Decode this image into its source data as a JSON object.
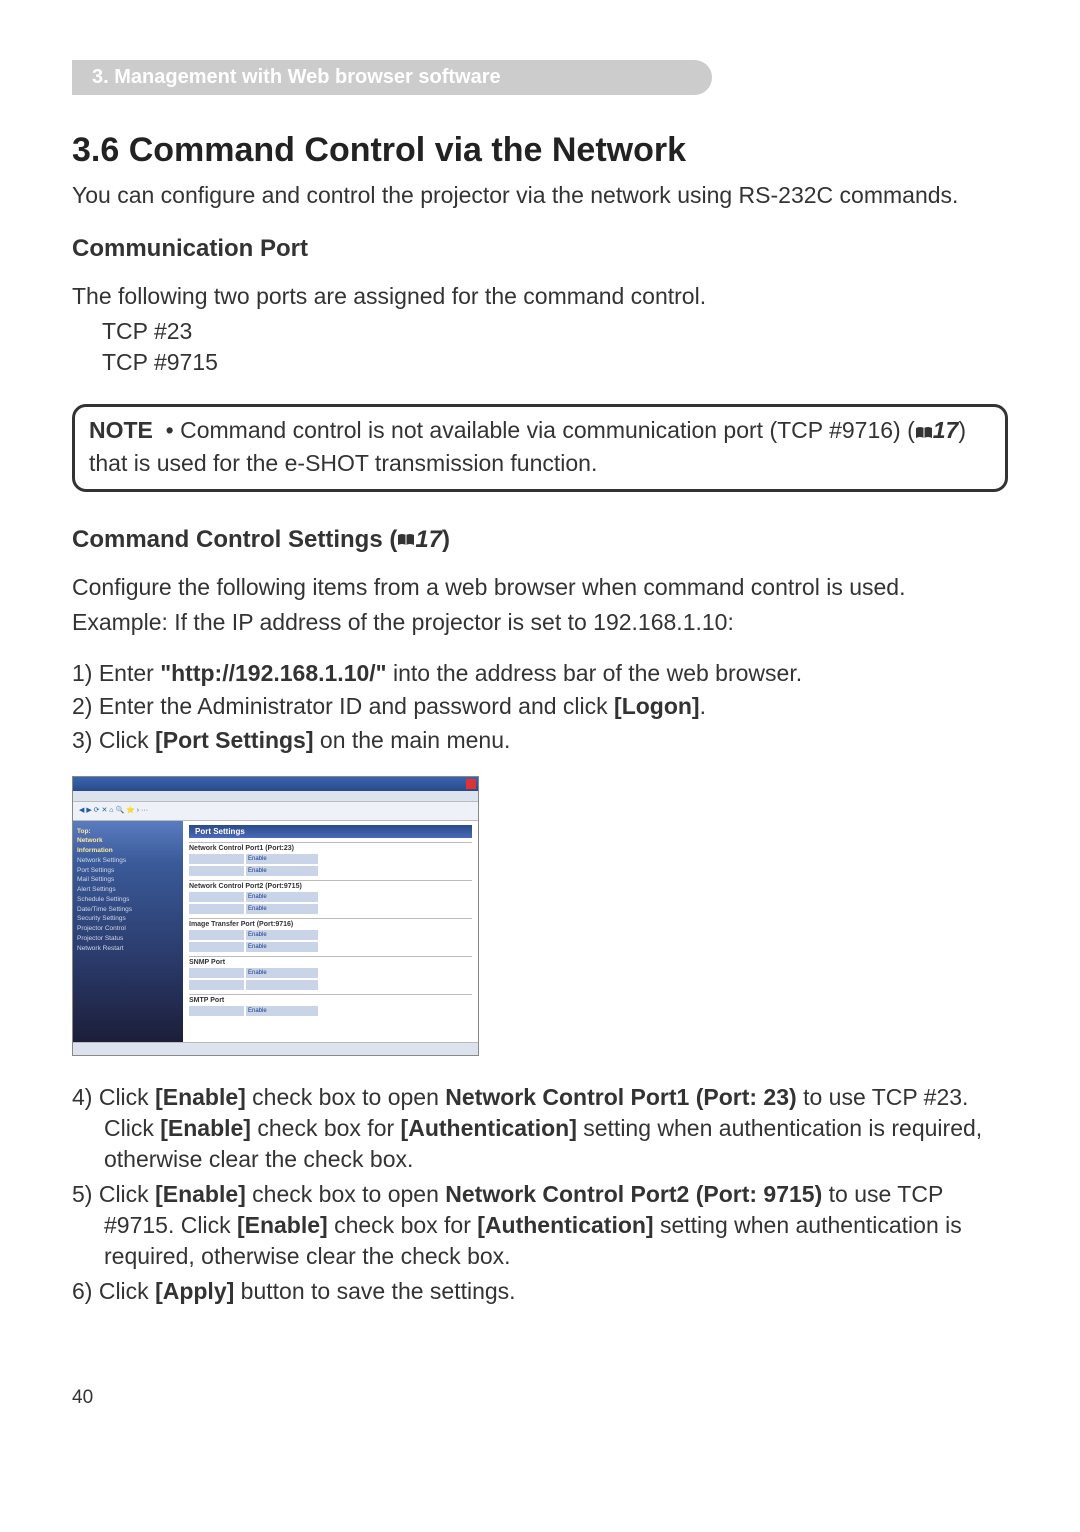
{
  "breadcrumb": "3. Management with Web browser software",
  "title": "3.6 Command Control via the Network",
  "intro": "You can configure and control the projector via the network using RS-232C commands.",
  "comm_port_heading": "Communication Port",
  "comm_port_text": "The following two ports are assigned for the command control.",
  "ports": [
    "TCP #23",
    "TCP #9715"
  ],
  "note_label": "NOTE",
  "note_bullet": "•",
  "note_text_a": "Command control is not available via communication port (TCP #9716) (",
  "note_ref": "17",
  "note_text_b": ") that is used for the e-SHOT transmission function.",
  "settings_heading_a": "Command Control Settings (",
  "settings_heading_ref": "17",
  "settings_heading_b": ")",
  "config_line1": "Configure the following items from a web browser when command control is used.",
  "config_line2": "Example: If the IP address of the projector is set to 192.168.1.10:",
  "steps1": [
    {
      "n": "1)",
      "pre": "Enter ",
      "q": "\"http://192.168.1.10/\"",
      "post": " into the address bar of the web browser."
    },
    {
      "n": "2)",
      "pre": "Enter the Administrator ID and password and click ",
      "b": "[Logon]",
      "post": "."
    },
    {
      "n": "3)",
      "pre": "Click ",
      "b": "[Port Settings]",
      "post": " on the main menu."
    }
  ],
  "screenshot": {
    "window_title": "Port Settings",
    "sidebar_items": [
      "Top:",
      "Network",
      "Information",
      "Network Settings",
      "Port Settings",
      "Mail Settings",
      "Alert Settings",
      "Schedule Settings",
      "Date/Time Settings",
      "Security Settings",
      "Projector Control",
      "Projector Status",
      "Network Restart"
    ],
    "sections": [
      {
        "label": "Network Control Port1 (Port:23)",
        "rows": [
          "Enable",
          "Enable"
        ]
      },
      {
        "label": "Network Control Port2 (Port:9715)",
        "rows": [
          "Enable",
          "Enable"
        ]
      },
      {
        "label": "Image Transfer Port (Port:9716)",
        "rows": [
          "Enable",
          "Enable"
        ]
      },
      {
        "label": "SNMP Port",
        "rows": [
          "Enable",
          ""
        ]
      },
      {
        "label": "SMTP Port",
        "rows": [
          "Enable"
        ]
      }
    ]
  },
  "steps2": [
    {
      "n": "4)",
      "parts": [
        "Click ",
        {
          "b": "[Enable]"
        },
        " check box to open ",
        {
          "b": "Network Control Port1 (Port: 23)"
        },
        " to use TCP #23. Click ",
        {
          "b": "[Enable]"
        },
        " check box for ",
        {
          "b": "[Authentication]"
        },
        " setting when authentication is required, otherwise clear the check box."
      ]
    },
    {
      "n": "5)",
      "parts": [
        "Click ",
        {
          "b": "[Enable]"
        },
        " check box to open ",
        {
          "b": "Network Control Port2 (Port: 9715)"
        },
        " to use TCP #9715. Click ",
        {
          "b": "[Enable]"
        },
        " check box for ",
        {
          "b": "[Authentication]"
        },
        " setting when authentication is required, otherwise clear the check box."
      ]
    },
    {
      "n": "6)",
      "parts": [
        "Click ",
        {
          "b": "[Apply]"
        },
        " button to save the settings."
      ]
    }
  ],
  "page_number": "40"
}
